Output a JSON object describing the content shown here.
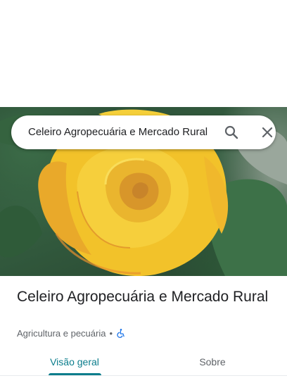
{
  "search": {
    "query": "Celeiro Agropecuária e Mercado Rural"
  },
  "place": {
    "name": "Celeiro Agropecuária e Mercado Rural",
    "category": "Agricultura e pecuária",
    "separator": "•",
    "accessibility_icon": "wheelchair-icon"
  },
  "tabs": [
    {
      "label": "Visão geral",
      "active": true
    },
    {
      "label": "Sobre",
      "active": false
    }
  ],
  "colors": {
    "accent": "#0b7d8c",
    "accessibility": "#1a73e8"
  },
  "icons": {
    "search": "search-icon",
    "close": "close-icon"
  }
}
